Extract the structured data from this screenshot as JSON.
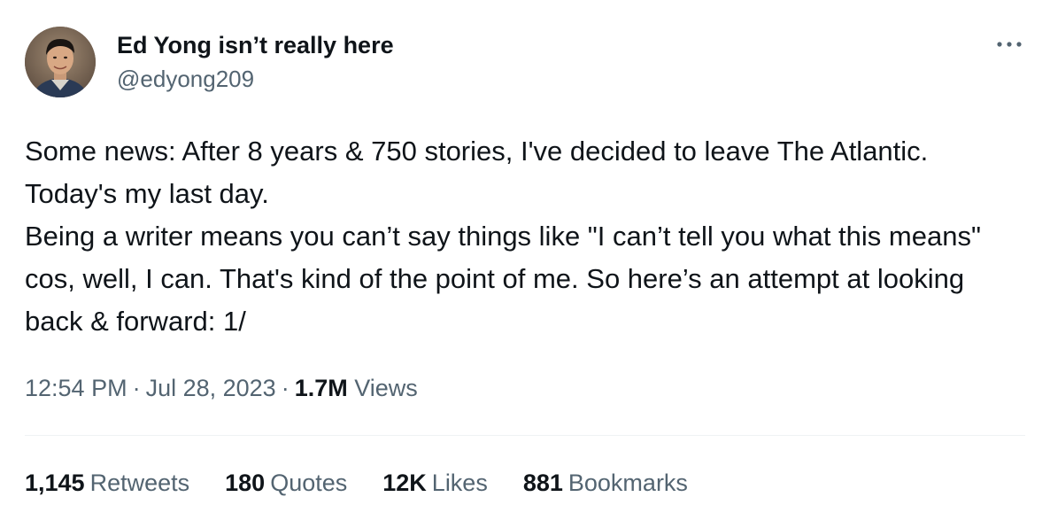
{
  "author": {
    "display_name": "Ed Yong isn’t really here",
    "handle": "@edyong209"
  },
  "tweet": {
    "lines": [
      "Some news: After 8 years & 750 stories, I've decided to leave The Atlantic. Today's my last day.",
      "Being a writer means you can’t say things like \"I can’t tell you what this means\" cos, well, I can. That's kind of the point of me. So here’s an attempt at looking back & forward: 1/"
    ]
  },
  "meta": {
    "time": "12:54 PM",
    "separator": "·",
    "date": "Jul 28, 2023",
    "views_count": "1.7M",
    "views_label": "Views"
  },
  "stats": {
    "retweets": {
      "count": "1,145",
      "label": "Retweets"
    },
    "quotes": {
      "count": "180",
      "label": "Quotes"
    },
    "likes": {
      "count": "12K",
      "label": "Likes"
    },
    "bookmarks": {
      "count": "881",
      "label": "Bookmarks"
    }
  },
  "icons": {
    "more": "more-options-icon"
  },
  "colors": {
    "text_primary": "#0f1419",
    "text_secondary": "#536471",
    "divider": "#eff3f4"
  }
}
